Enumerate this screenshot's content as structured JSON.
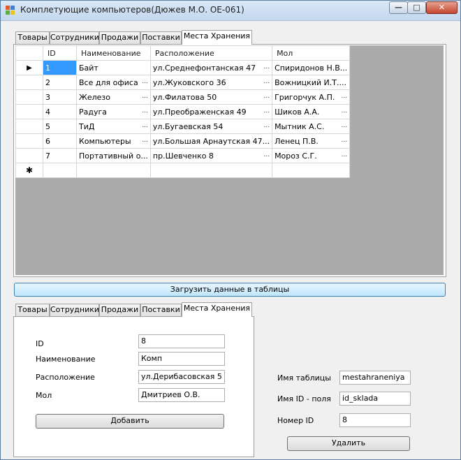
{
  "window": {
    "title": "Комплетующие компьютеров(Дюжев М.О. ОЕ-061)",
    "buttons": {
      "minimize": "—",
      "maximize": "□",
      "close": "✕"
    }
  },
  "top_tabs": [
    "Товары",
    "Сотрудники",
    "Продажи",
    "Поставки",
    "Места Хранения"
  ],
  "grid": {
    "columns": [
      "ID",
      "Наименование",
      "Расположение",
      "Мол"
    ],
    "rows": [
      [
        "1",
        "Байт",
        "ул.Среднефонтанская 47",
        "Спиридонов Н.В..."
      ],
      [
        "2",
        "Все для офиса",
        "ул.Жуковского 36",
        "Вожницкий И.Т...."
      ],
      [
        "3",
        "Железо",
        "ул.Филатова 50",
        "Григорчук А.П."
      ],
      [
        "4",
        "Радуга",
        "ул.Преображенская 49",
        "Шиков А.А."
      ],
      [
        "5",
        "ТиД",
        "ул.Бугаевская 54",
        "Мытник А.С."
      ],
      [
        "6",
        "Компьютеры",
        "ул.Большая Арнаутская 47...",
        "Ленец П.В."
      ],
      [
        "7",
        "Портативный о...",
        "пр.Шевченко 8",
        "Мороз С.Г."
      ]
    ],
    "current_marker": "▶",
    "new_row_marker": "✱",
    "ellipsis": "..."
  },
  "load_button": "Загрузить данные в таблицы",
  "bottom_tabs": [
    "Товары",
    "Сотрудники",
    "Продажи",
    "Поставки",
    "Места Хранения"
  ],
  "form": {
    "labels": [
      "ID",
      "Наименование",
      "Расположение",
      "Мол"
    ],
    "values": [
      "8",
      "Комп",
      "ул.Дерибасовская 5",
      "Дмитриев О.В."
    ],
    "add_button": "Добавить"
  },
  "delete_panel": {
    "labels": [
      "Имя таблицы",
      "Имя ID - поля",
      "Номер ID"
    ],
    "values": [
      "mestahraneniya",
      "id_sklada",
      "8"
    ],
    "delete_button": "Удалить"
  },
  "colors": {
    "selection": "#3399ff",
    "grid_background": "#ababab",
    "window_face": "#f0f0f0"
  }
}
